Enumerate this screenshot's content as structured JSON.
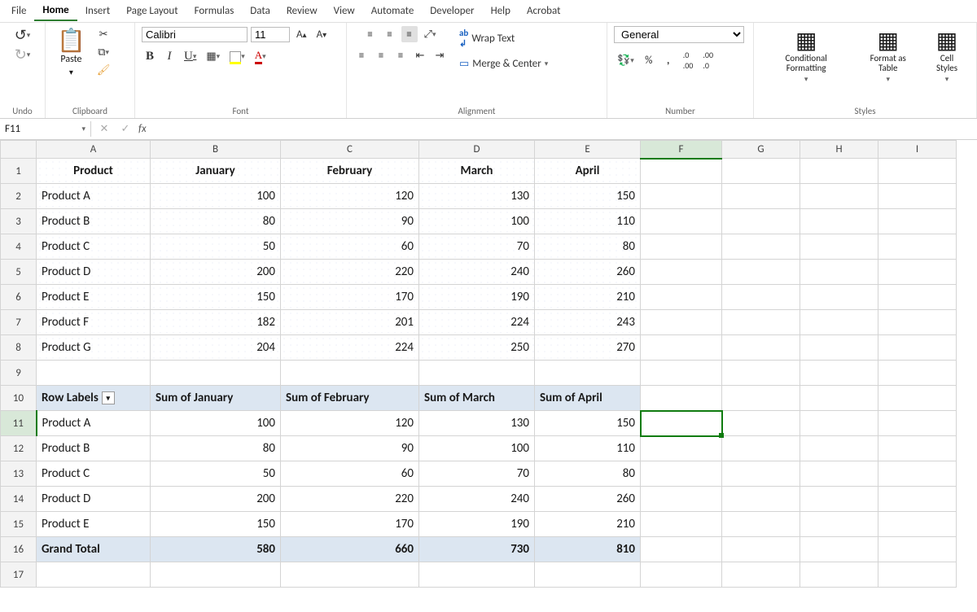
{
  "tabs": [
    "File",
    "Home",
    "Insert",
    "Page Layout",
    "Formulas",
    "Data",
    "Review",
    "View",
    "Automate",
    "Developer",
    "Help",
    "Acrobat"
  ],
  "active_tab": "Home",
  "ribbon": {
    "undo_label": "Undo",
    "clipboard_label": "Clipboard",
    "paste_label": "Paste",
    "font_label": "Font",
    "font_name": "Calibri",
    "font_size": "11",
    "alignment_label": "Alignment",
    "wrap_text_label": "Wrap Text",
    "merge_center_label": "Merge & Center",
    "number_label": "Number",
    "number_format": "General",
    "styles_label": "Styles",
    "cond_fmt_label": "Conditional Formatting",
    "fmt_table_label": "Format as Table",
    "cell_styles_label": "Cell Styles"
  },
  "namebox": "F11",
  "formula_bar": "",
  "columns": [
    "A",
    "B",
    "C",
    "D",
    "E",
    "F",
    "G",
    "H",
    "I"
  ],
  "selected_cell": {
    "row": 11,
    "col": "F"
  },
  "data_table": {
    "headers": [
      "Product",
      "January",
      "February",
      "March",
      "April"
    ],
    "rows": [
      [
        "Product A",
        100,
        120,
        130,
        150
      ],
      [
        "Product B",
        80,
        90,
        100,
        110
      ],
      [
        "Product C",
        50,
        60,
        70,
        80
      ],
      [
        "Product D",
        200,
        220,
        240,
        260
      ],
      [
        "Product E",
        150,
        170,
        190,
        210
      ],
      [
        "Product F",
        182,
        201,
        224,
        243
      ],
      [
        "Product G",
        204,
        224,
        250,
        270
      ]
    ]
  },
  "pivot": {
    "row_labels_header": "Row Labels",
    "headers": [
      "Sum of January",
      "Sum of February",
      "Sum of March",
      "Sum of April"
    ],
    "rows": [
      [
        "Product A",
        100,
        120,
        130,
        150
      ],
      [
        "Product B",
        80,
        90,
        100,
        110
      ],
      [
        "Product C",
        50,
        60,
        70,
        80
      ],
      [
        "Product D",
        200,
        220,
        240,
        260
      ],
      [
        "Product E",
        150,
        170,
        190,
        210
      ]
    ],
    "grand_total_label": "Grand Total",
    "grand_total": [
      580,
      660,
      730,
      810
    ]
  }
}
